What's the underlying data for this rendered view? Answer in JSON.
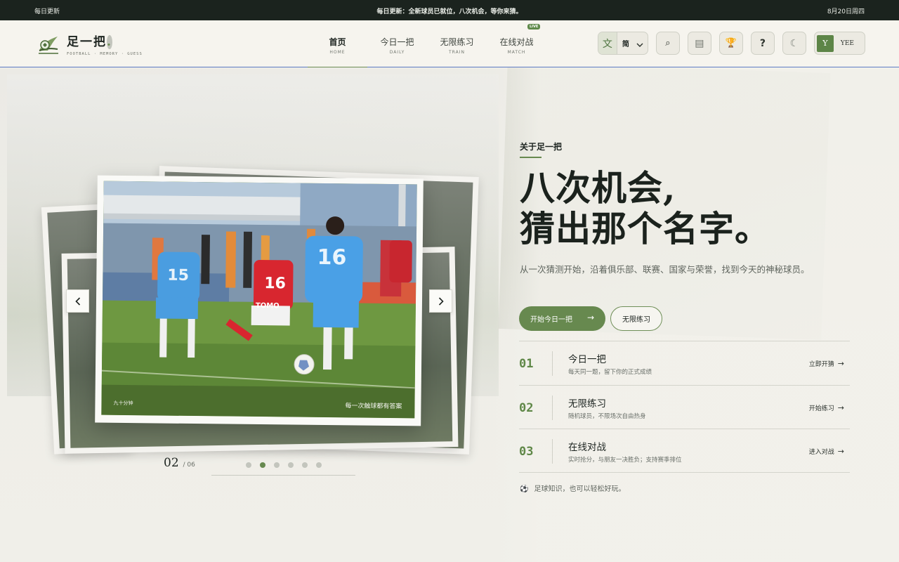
{
  "topbar": {
    "left": "每日更新",
    "center": "每日更新：全新球员已就位，八次机会，等你来猜。",
    "right": "8月20日周四"
  },
  "brand": {
    "name": "足一把",
    "tagline": "FOOTBALL · MEMORY · GUESS"
  },
  "nav": {
    "items": [
      {
        "zh": "首页",
        "en": "HOME"
      },
      {
        "zh": "今日一把",
        "en": "DAILY"
      },
      {
        "zh": "无限练习",
        "en": "TRAIN"
      },
      {
        "zh": "在线对战",
        "en": "MATCH"
      }
    ],
    "live_badge": "LIVE"
  },
  "tools": {
    "lang_icon": "文",
    "lang_value": "简",
    "search_icon": "⌕",
    "book_icon": "▤",
    "trophy_icon": "🏆",
    "help_icon": "?",
    "theme_icon": "☾",
    "avatar_initial": "Y",
    "username": "YEE"
  },
  "carousel": {
    "caption_left": "九十分钟",
    "caption_right": "每一次触球都有答案",
    "current": "02",
    "total": "06",
    "slides": 6,
    "active_index": 1,
    "jersey_numbers": [
      "15",
      "16",
      "16"
    ],
    "sponsor_text": "TOMO"
  },
  "hero": {
    "eyebrow": "关于足一把",
    "headline_line1": "八次机会,",
    "headline_line2": "猜出那个名字。",
    "subtext": "从一次猜测开始，沿着俱乐部、联赛、国家与荣誉，找到今天的神秘球员。",
    "primary_button": "开始今日一把",
    "primary_arrow": "→",
    "secondary_button": "无限练习"
  },
  "modes": [
    {
      "num": "01",
      "title": "今日一把",
      "desc": "每天同一题，留下你的正式成绩",
      "cta": "立即开猜"
    },
    {
      "num": "02",
      "title": "无限练习",
      "desc": "随机球员，不限场次自由热身",
      "cta": "开始练习"
    },
    {
      "num": "03",
      "title": "在线对战",
      "desc": "实时抢分，与朋友一决胜负；支持赛季排位",
      "cta": "进入对战"
    }
  ],
  "footnote": "足球知识，也可以轻松好玩。",
  "colors": {
    "accent": "#67894f",
    "dark": "#1b231e"
  }
}
